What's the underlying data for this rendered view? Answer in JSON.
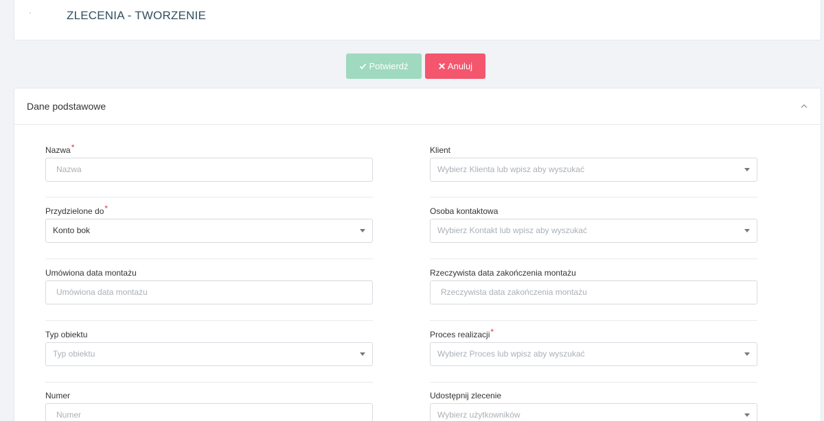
{
  "header": {
    "title": "ZLECENIA - TWORZENIE"
  },
  "actions": {
    "confirm_label": "Potwierdź",
    "cancel_label": "Anuluj",
    "confirm_color": "#9fd9bf",
    "cancel_color": "#f4566e"
  },
  "panel": {
    "title": "Dane podstawowe"
  },
  "fields": {
    "nazwa": {
      "label": "Nazwa",
      "placeholder": "Nazwa",
      "required_mark": "*"
    },
    "klient": {
      "label": "Klient",
      "placeholder": "Wybierz Klienta lub wpisz aby wyszukać"
    },
    "przydzielone": {
      "label": "Przydzielone do",
      "value": "Konto bok",
      "required_mark": "*"
    },
    "osoba": {
      "label": "Osoba kontaktowa",
      "placeholder": "Wybierz Kontakt lub wpisz aby wyszukać"
    },
    "data_montazu": {
      "label": "Umówiona data montażu",
      "placeholder": "Umówiona data montażu"
    },
    "data_zakonczenia": {
      "label": "Rzeczywista data zakończenia montażu",
      "placeholder": "Rzeczywista data zakończenia montażu"
    },
    "typ_obiektu": {
      "label": "Typ obiektu",
      "placeholder": "Typ obiektu"
    },
    "proces": {
      "label": "Proces realizacji",
      "placeholder": "Wybierz Proces lub wpisz aby wyszukać",
      "required_mark": "*"
    },
    "numer": {
      "label": "Numer",
      "placeholder": "Numer"
    },
    "udostepnij": {
      "label": "Udostępnij zlecenie",
      "placeholder": "Wybierz użytkowników"
    }
  }
}
